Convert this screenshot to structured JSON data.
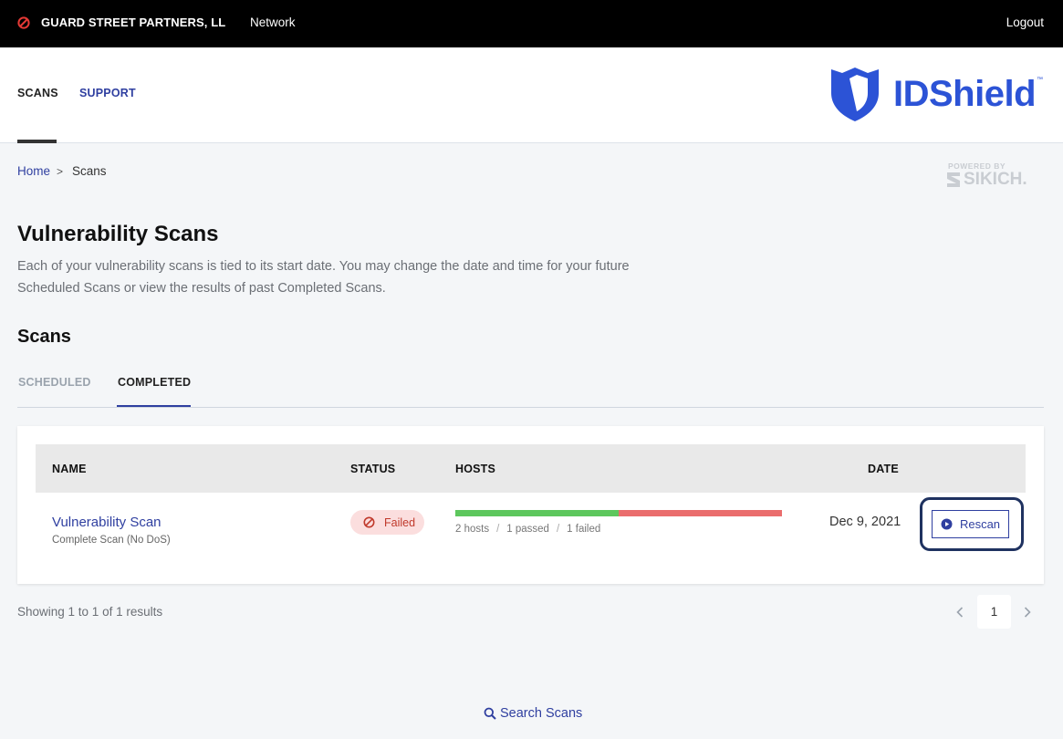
{
  "topbar": {
    "org_name": "GUARD STREET PARTNERS, LL",
    "network_label": "Network",
    "logout_label": "Logout"
  },
  "header": {
    "nav": {
      "scans_label": "SCANS",
      "support_label": "SUPPORT"
    },
    "logo_text": "IDShield",
    "logo_tm": "™"
  },
  "breadcrumb": {
    "home": "Home",
    "separator": ">",
    "current": "Scans"
  },
  "powered_by": {
    "small": "POWERED BY",
    "brand": "SIKICH."
  },
  "page": {
    "title": "Vulnerability Scans",
    "description": "Each of your vulnerability scans is tied to its start date. You may change the date and time for your future Scheduled Scans or view the results of past Completed Scans."
  },
  "scans_section": {
    "title": "Scans",
    "tabs": {
      "scheduled": "SCHEDULED",
      "completed": "COMPLETED"
    },
    "active_tab": "completed"
  },
  "table": {
    "columns": {
      "name": "NAME",
      "status": "STATUS",
      "hosts": "HOSTS",
      "date": "DATE"
    },
    "rows": [
      {
        "name": "Vulnerability Scan",
        "subtitle": "Complete Scan (No DoS)",
        "status": "Failed",
        "hosts_total": "2 hosts",
        "hosts_passed": "1 passed",
        "hosts_failed": "1 failed",
        "passed_fraction": 0.5,
        "date": "Dec 9, 2021",
        "action_label": "Rescan"
      }
    ]
  },
  "footer": {
    "showing": "Showing 1 to 1 of 1 results",
    "current_page": "1",
    "search_label": "Search Scans"
  },
  "colors": {
    "topbar_bg": "#000000",
    "link_blue": "#2f3fa0",
    "logo_blue": "#2c53d6",
    "pass_green": "#5dc75d",
    "fail_red": "#ea6d6d",
    "failed_badge_bg": "#fbdede",
    "failed_text": "#c0392b",
    "highlight_ring": "#1f3260"
  },
  "icons": {
    "org": "no-entry-icon",
    "logo": "shield-icon",
    "status_failed": "no-entry-icon",
    "rescan": "play-circle-icon",
    "search": "search-icon",
    "pager_prev": "chevron-left-icon",
    "pager_next": "chevron-right-icon"
  }
}
